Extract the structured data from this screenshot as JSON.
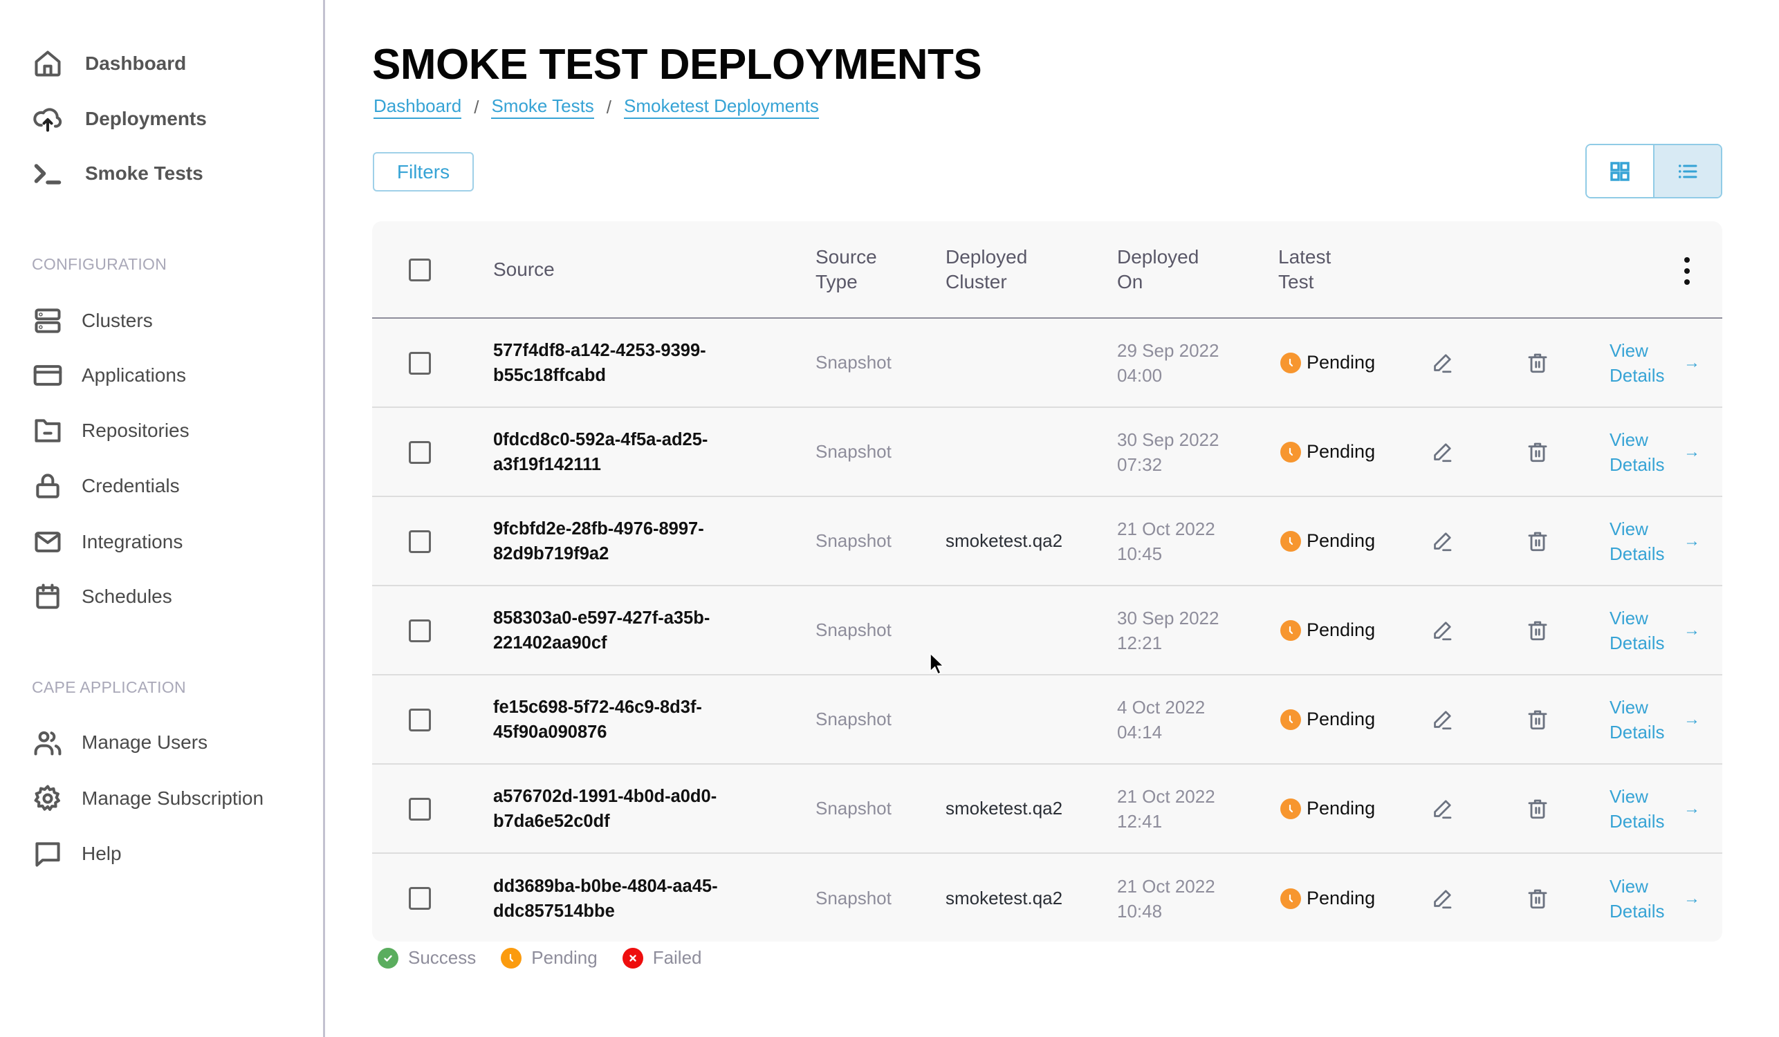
{
  "sidebar": {
    "primary": [
      {
        "label": "Dashboard",
        "icon": "home-icon"
      },
      {
        "label": "Deployments",
        "icon": "cloud-upload-icon"
      },
      {
        "label": "Smoke Tests",
        "icon": "terminal-icon"
      }
    ],
    "sections": [
      {
        "title": "CONFIGURATION",
        "items": [
          {
            "label": "Clusters",
            "icon": "server-icon"
          },
          {
            "label": "Applications",
            "icon": "credit-card-icon"
          },
          {
            "label": "Repositories",
            "icon": "folder-minus-icon"
          },
          {
            "label": "Credentials",
            "icon": "lock-icon"
          },
          {
            "label": "Integrations",
            "icon": "mail-icon"
          },
          {
            "label": "Schedules",
            "icon": "calendar-icon"
          }
        ]
      },
      {
        "title": "CAPE APPLICATION",
        "items": [
          {
            "label": "Manage Users",
            "icon": "users-icon"
          },
          {
            "label": "Manage Subscription",
            "icon": "gear-icon"
          },
          {
            "label": "Help",
            "icon": "chat-bubble-icon"
          }
        ]
      }
    ]
  },
  "header": {
    "title": "SMOKE TEST DEPLOYMENTS",
    "breadcrumb": [
      "Dashboard",
      "Smoke Tests",
      "Smoketest Deployments"
    ],
    "breadcrumb_separator": "/"
  },
  "toolbar": {
    "filters_label": "Filters",
    "view_modes": [
      {
        "name": "grid",
        "icon": "grid-icon",
        "active": false
      },
      {
        "name": "list",
        "icon": "list-icon",
        "active": true
      }
    ]
  },
  "table": {
    "columns": {
      "source": "Source",
      "source_type_1": "Source",
      "source_type_2": "Type",
      "cluster_1": "Deployed",
      "cluster_2": "Cluster",
      "deployed_on_1": "Deployed",
      "deployed_on_2": "On",
      "latest_test_1": "Latest",
      "latest_test_2": "Test"
    },
    "view_details_1": "View",
    "view_details_2": "Details",
    "arrow": "→",
    "rows": [
      {
        "source_1": "577f4df8-a142-4253-9399-",
        "source_2": "b55c18ffcabd",
        "source_type": "Snapshot",
        "cluster": "",
        "date": "29 Sep 2022",
        "time": "04:00",
        "status": "Pending"
      },
      {
        "source_1": "0fdcd8c0-592a-4f5a-ad25-",
        "source_2": "a3f19f142111",
        "source_type": "Snapshot",
        "cluster": "",
        "date": "30 Sep 2022",
        "time": "07:32",
        "status": "Pending"
      },
      {
        "source_1": "9fcbfd2e-28fb-4976-8997-",
        "source_2": "82d9b719f9a2",
        "source_type": "Snapshot",
        "cluster": "smoketest.qa2",
        "date": "21 Oct 2022",
        "time": "10:45",
        "status": "Pending"
      },
      {
        "source_1": "858303a0-e597-427f-a35b-",
        "source_2": "221402aa90cf",
        "source_type": "Snapshot",
        "cluster": "",
        "date": "30 Sep 2022",
        "time": "12:21",
        "status": "Pending"
      },
      {
        "source_1": "fe15c698-5f72-46c9-8d3f-",
        "source_2": "45f90a090876",
        "source_type": "Snapshot",
        "cluster": "",
        "date": "4 Oct 2022",
        "time": "04:14",
        "status": "Pending"
      },
      {
        "source_1": "a576702d-1991-4b0d-a0d0-",
        "source_2": "b7da6e52c0df",
        "source_type": "Snapshot",
        "cluster": "smoketest.qa2",
        "date": "21 Oct 2022",
        "time": "12:41",
        "status": "Pending"
      },
      {
        "source_1": "dd3689ba-b0be-4804-aa45-",
        "source_2": "ddc857514bbe",
        "source_type": "Snapshot",
        "cluster": "smoketest.qa2",
        "date": "21 Oct 2022",
        "time": "10:48",
        "status": "Pending"
      }
    ]
  },
  "legend": [
    {
      "label": "Success",
      "color": "#5aad5e",
      "icon": "check-circle-icon"
    },
    {
      "label": "Pending",
      "color": "#f7962f",
      "icon": "clock-icon"
    },
    {
      "label": "Failed",
      "color": "#ee0e0e",
      "icon": "x-circle-icon"
    }
  ],
  "colors": {
    "accent": "#36a3d5",
    "pending": "#f7962f",
    "success": "#5aad5e",
    "failed": "#ee0e0e"
  }
}
